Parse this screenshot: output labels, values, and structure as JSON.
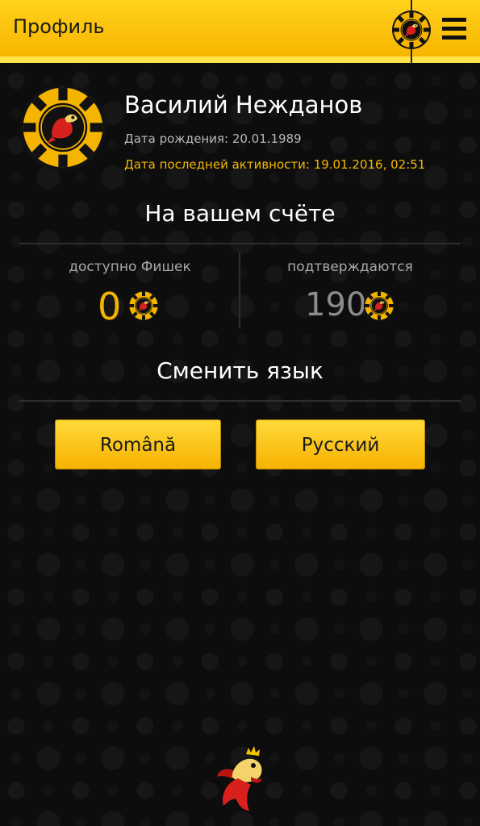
{
  "header": {
    "title": "Профиль",
    "chip_icon": "casino-chip-icon",
    "menu_icon": "hamburger-menu-icon"
  },
  "profile": {
    "name": "Василий Нежданов",
    "birth_date": "Дата рождения: 20.01.1989",
    "last_activity": "Дата последней активности: 19.01.2016, 02:51",
    "avatar_icon": "casino-chip-avatar-icon"
  },
  "account": {
    "title": "На вашем счёте",
    "available": {
      "label": "доступно Фишек",
      "value": "0"
    },
    "pending": {
      "label": "подтверждаются",
      "value": "190"
    }
  },
  "language": {
    "title": "Сменить язык",
    "romanian_label": "Română",
    "russian_label": "Русский"
  },
  "colors": {
    "accent": "#f7b500",
    "background": "#0d0d0d",
    "muted_text": "#a8a8a8"
  },
  "footer": {
    "mascot_icon": "goldfish-mascot-icon"
  }
}
